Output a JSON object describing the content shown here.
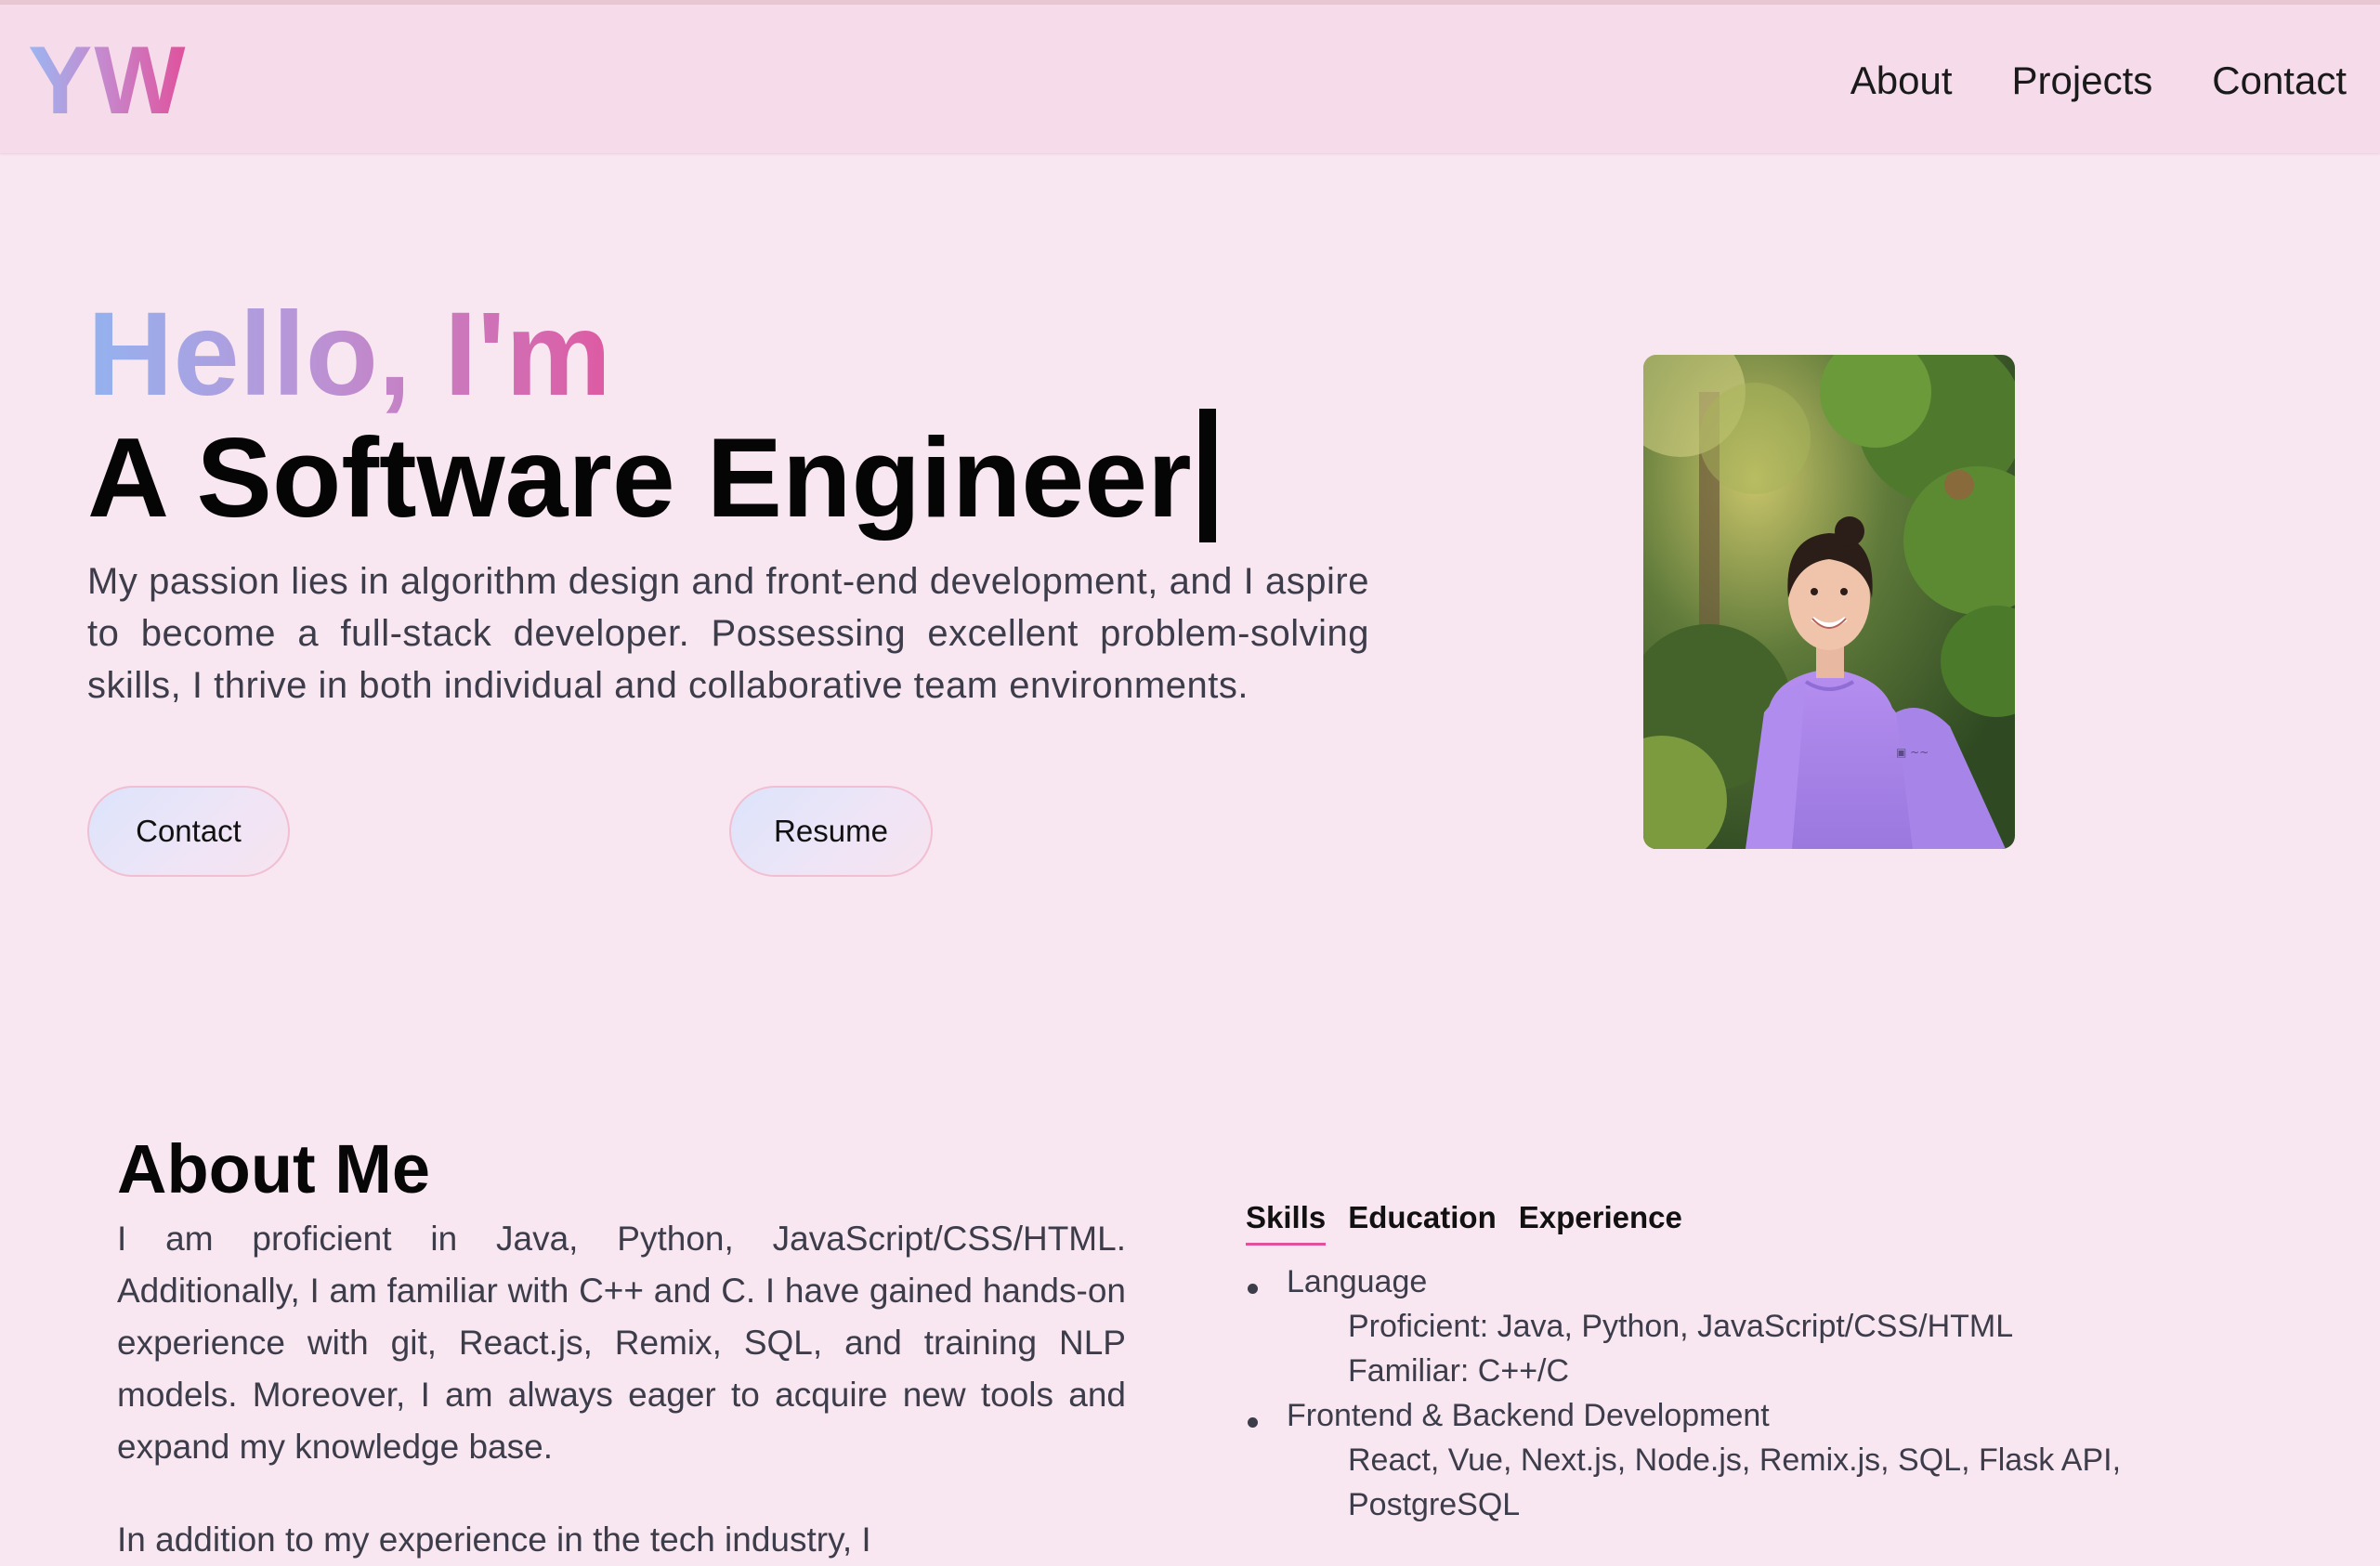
{
  "nav": {
    "logo": "YW",
    "links": [
      "About",
      "Projects",
      "Contact"
    ]
  },
  "hero": {
    "greeting": "Hello, I'm",
    "role": "A Software Engineer",
    "description": "My passion lies in algorithm design and front-end development, and I aspire to become a full-stack developer. Possessing excellent problem-solving skills, I thrive in both individual and collaborative team environments.",
    "contact_button": "Contact",
    "resume_button": "Resume"
  },
  "about": {
    "title": "About Me",
    "paragraph1": "I am proficient in Java, Python, JavaScript/CSS/HTML. Additionally, I am familiar with C++ and C. I have gained hands-on experience with git, React.js, Remix, SQL, and training NLP models. Moreover, I am always eager to acquire new tools and expand my knowledge base.",
    "paragraph2_partial": "In addition to my experience in the tech industry, I"
  },
  "tabs": {
    "items": [
      "Skills",
      "Education",
      "Experience"
    ],
    "active": "Skills"
  },
  "skills": [
    {
      "title": "Language",
      "details": [
        "Proficient: Java, Python, JavaScript/CSS/HTML",
        "Familiar: C++/C"
      ]
    },
    {
      "title": "Frontend & Backend Development",
      "details": [
        "React, Vue, Next.js, Node.js, Remix.js, SQL, Flask API,",
        "PostgreSQL"
      ]
    }
  ],
  "colors": {
    "background": "#f8e7f0",
    "navbar": "#f6dbea",
    "accent_pink": "#e0509b",
    "accent_blue": "#94b2f0"
  },
  "icons": {
    "profile_photo": "profile-photo"
  }
}
